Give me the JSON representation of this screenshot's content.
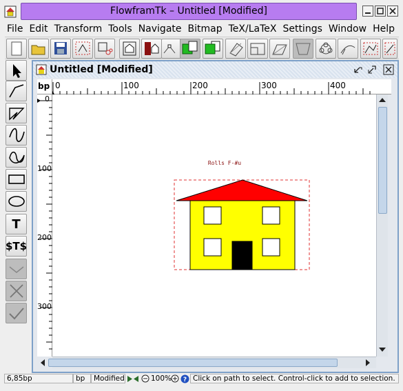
{
  "window": {
    "title": "FlowframTk – Untitled [Modified]",
    "controls": [
      "minimize",
      "maximize",
      "close"
    ]
  },
  "menubar": {
    "items": [
      "File",
      "Edit",
      "Transform",
      "Tools",
      "Navigate",
      "Bitmap",
      "TeX/LaTeX",
      "Settings",
      "Window",
      "Help"
    ]
  },
  "toolbar": {
    "buttons": [
      "new-icon",
      "open-icon",
      "save-icon",
      "select-all-icon",
      "cut-icon",
      "group-icon",
      "ungroup-icon",
      "select-paths-icon",
      "move-forward-icon",
      "move-backward-icon",
      "path-edit-icon",
      "align-icon",
      "rotate-icon",
      "scale-icon",
      "shear-icon",
      "bitmap-icon",
      "pattern-icon",
      "text-path-icon",
      "grid-icon",
      "snap-icon"
    ]
  },
  "tools": {
    "items": [
      "select-tool",
      "open-line-tool",
      "closed-line-tool",
      "open-curve-tool",
      "closed-curve-tool",
      "rectangle-tool",
      "ellipse-tool",
      "text-tool",
      "math-tool",
      "abandon-tool",
      "finish-tool",
      "confirm-tool"
    ],
    "text_label": "T",
    "math_label": "$T$"
  },
  "document": {
    "title": "Untitled [Modified]",
    "unit": "bp",
    "ruler_top": [
      "0",
      "100",
      "200",
      "300",
      "400"
    ],
    "ruler_left": [
      "0",
      "100",
      "200",
      "300"
    ],
    "text_object": "Rolls F-#u",
    "colors": {
      "roof": "#ff0000",
      "walls": "#ffff00",
      "windows": "#ffffff",
      "door": "#000000",
      "selection": "#e03030"
    }
  },
  "status": {
    "position": "6,85bp",
    "unit": "bp",
    "modified": "Modified",
    "zoom": "100%",
    "message": "Click on path to select. Control-click to add to selection. Doubl"
  }
}
